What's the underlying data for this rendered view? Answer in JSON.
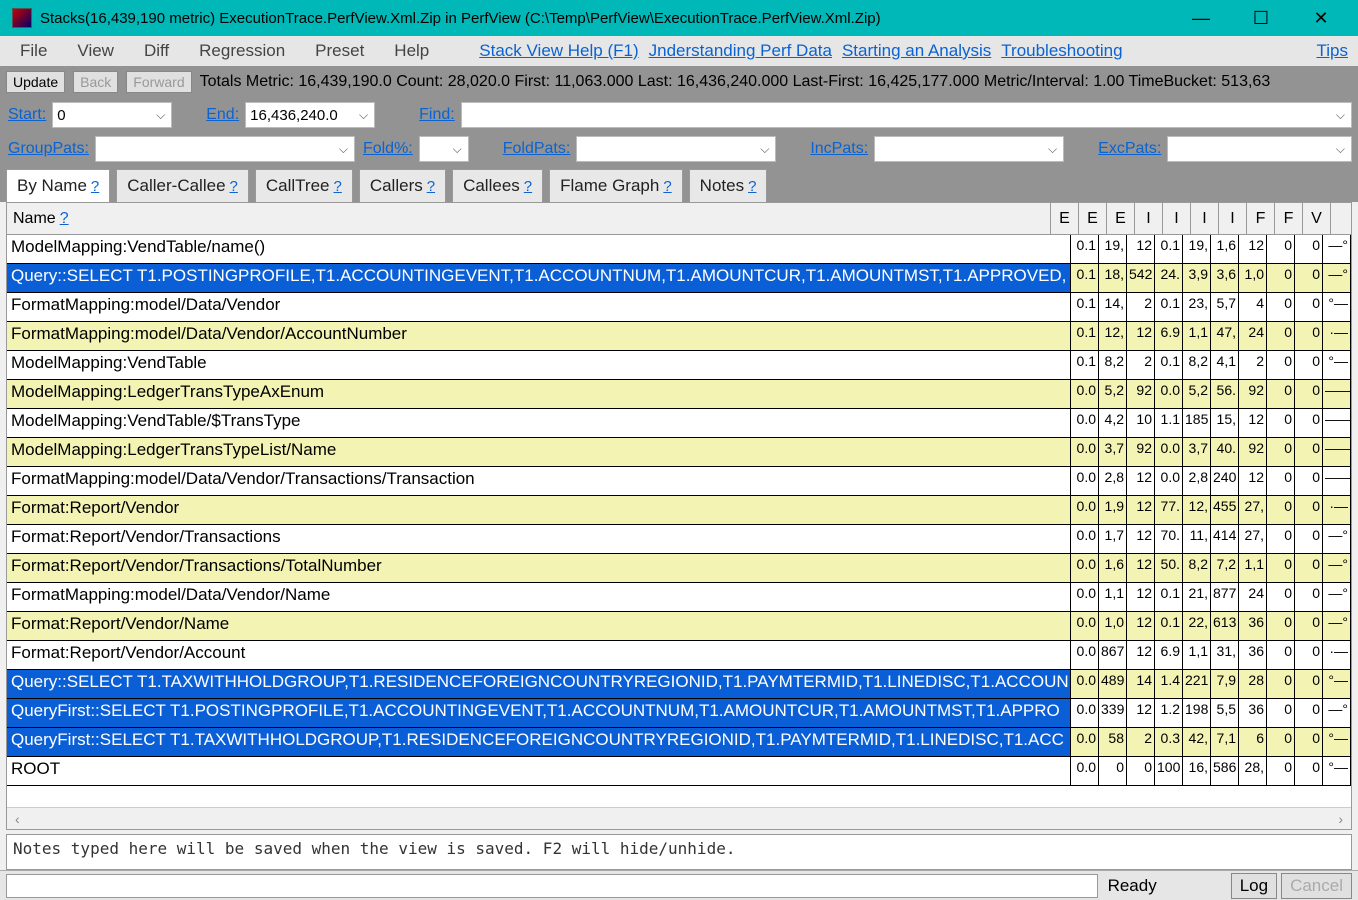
{
  "window": {
    "title": "Stacks(16,439,190 metric) ExecutionTrace.PerfView.Xml.Zip in PerfView (C:\\Temp\\PerfView\\ExecutionTrace.PerfView.Xml.Zip)"
  },
  "menubar": {
    "items": [
      "File",
      "View",
      "Diff",
      "Regression",
      "Preset",
      "Help"
    ],
    "links": {
      "stackview": "Stack View Help (F1)",
      "understanding": "Jnderstanding Perf Data",
      "starting": "Starting an Analysis",
      "troubleshooting": "Troubleshooting",
      "tips": "Tips"
    }
  },
  "toolbar": {
    "update": "Update",
    "back": "Back",
    "forward": "Forward",
    "totals": "Totals Metric: 16,439,190.0   Count: 28,020.0   First: 11,063.000  Last: 16,436,240.000   Last-First: 16,425,177.000   Metric/Interval: 1.00   TimeBucket: 513,63"
  },
  "filterbar1": {
    "start_label": "Start:",
    "start_value": "0",
    "end_label": "End:",
    "end_value": "16,436,240.0",
    "find_label": "Find:"
  },
  "filterbar2": {
    "grouppats": "GroupPats:",
    "foldpct": "Fold%:",
    "foldpats": "FoldPats:",
    "incpats": "IncPats:",
    "excpats": "ExcPats:"
  },
  "tabs": [
    "By Name",
    "Caller-Callee",
    "CallTree",
    "Callers",
    "Callees",
    "Flame Graph",
    "Notes"
  ],
  "grid": {
    "headers": {
      "name": "Name",
      "cols": [
        "E",
        "E",
        "E",
        "I",
        "I",
        "I",
        "I",
        "F",
        "F",
        "V"
      ]
    },
    "rows": [
      {
        "name": "ModelMapping:VendTable/name()",
        "vals": [
          "0.1",
          "19,",
          "12",
          "0.1",
          "19,",
          "1,6",
          "12",
          "0",
          "0",
          "—°"
        ],
        "sel": false
      },
      {
        "name": "Query::SELECT T1.POSTINGPROFILE,T1.ACCOUNTINGEVENT,T1.ACCOUNTNUM,T1.AMOUNTCUR,T1.AMOUNTMST,T1.APPROVED,",
        "vals": [
          "0.1",
          "18,",
          "542",
          "24.",
          "3,9",
          "3,6",
          "1,0",
          "0",
          "0",
          "—°"
        ],
        "sel": true
      },
      {
        "name": "FormatMapping:model/Data/Vendor",
        "vals": [
          "0.1",
          "14,",
          "2",
          "0.1",
          "23,",
          "5,7",
          "4",
          "0",
          "0",
          "°—"
        ],
        "sel": false
      },
      {
        "name": "FormatMapping:model/Data/Vendor/AccountNumber",
        "vals": [
          "0.1",
          "12,",
          "12",
          "6.9",
          "1,1",
          "47,",
          "24",
          "0",
          "0",
          "·—"
        ],
        "sel": false
      },
      {
        "name": "ModelMapping:VendTable",
        "vals": [
          "0.1",
          "8,2",
          "2",
          "0.1",
          "8,2",
          "4,1",
          "2",
          "0",
          "0",
          "°—"
        ],
        "sel": false
      },
      {
        "name": "ModelMapping:LedgerTransTypeAxEnum",
        "vals": [
          "0.0",
          "5,2",
          "92",
          "0.0",
          "5,2",
          "56.",
          "92",
          "0",
          "0",
          "——"
        ],
        "sel": false
      },
      {
        "name": "ModelMapping:VendTable/$TransType",
        "vals": [
          "0.0",
          "4,2",
          "10",
          "1.1",
          "185",
          "15,",
          "12",
          "0",
          "0",
          "——"
        ],
        "sel": false
      },
      {
        "name": "ModelMapping:LedgerTransTypeList/Name",
        "vals": [
          "0.0",
          "3,7",
          "92",
          "0.0",
          "3,7",
          "40.",
          "92",
          "0",
          "0",
          "——"
        ],
        "sel": false
      },
      {
        "name": "FormatMapping:model/Data/Vendor/Transactions/Transaction",
        "vals": [
          "0.0",
          "2,8",
          "12",
          "0.0",
          "2,8",
          "240",
          "12",
          "0",
          "0",
          "——"
        ],
        "sel": false
      },
      {
        "name": "Format:Report/Vendor",
        "vals": [
          "0.0",
          "1,9",
          "12",
          "77.",
          "12,",
          "455",
          "27,",
          "0",
          "0",
          "·—"
        ],
        "sel": false
      },
      {
        "name": "Format:Report/Vendor/Transactions",
        "vals": [
          "0.0",
          "1,7",
          "12",
          "70.",
          "11,",
          "414",
          "27,",
          "0",
          "0",
          "—°"
        ],
        "sel": false
      },
      {
        "name": "Format:Report/Vendor/Transactions/TotalNumber",
        "vals": [
          "0.0",
          "1,6",
          "12",
          "50.",
          "8,2",
          "7,2",
          "1,1",
          "0",
          "0",
          "—°"
        ],
        "sel": false
      },
      {
        "name": "FormatMapping:model/Data/Vendor/Name",
        "vals": [
          "0.0",
          "1,1",
          "12",
          "0.1",
          "21,",
          "877",
          "24",
          "0",
          "0",
          "—°"
        ],
        "sel": false
      },
      {
        "name": "Format:Report/Vendor/Name",
        "vals": [
          "0.0",
          "1,0",
          "12",
          "0.1",
          "22,",
          "613",
          "36",
          "0",
          "0",
          "—°"
        ],
        "sel": false
      },
      {
        "name": "Format:Report/Vendor/Account",
        "vals": [
          "0.0",
          "867",
          "12",
          "6.9",
          "1,1",
          "31,",
          "36",
          "0",
          "0",
          "·—"
        ],
        "sel": false
      },
      {
        "name": "Query::SELECT T1.TAXWITHHOLDGROUP,T1.RESIDENCEFOREIGNCOUNTRYREGIONID,T1.PAYMTERMID,T1.LINEDISC,T1.ACCOUN",
        "vals": [
          "0.0",
          "489",
          "14",
          "1.4",
          "221",
          "7,9",
          "28",
          "0",
          "0",
          "°—"
        ],
        "sel": true
      },
      {
        "name": "QueryFirst::SELECT T1.POSTINGPROFILE,T1.ACCOUNTINGEVENT,T1.ACCOUNTNUM,T1.AMOUNTCUR,T1.AMOUNTMST,T1.APPRO",
        "vals": [
          "0.0",
          "339",
          "12",
          "1.2",
          "198",
          "5,5",
          "36",
          "0",
          "0",
          "—°"
        ],
        "sel": true
      },
      {
        "name": "QueryFirst::SELECT T1.TAXWITHHOLDGROUP,T1.RESIDENCEFOREIGNCOUNTRYREGIONID,T1.PAYMTERMID,T1.LINEDISC,T1.ACC",
        "vals": [
          "0.0",
          "58",
          "2",
          "0.3",
          "42,",
          "7,1",
          "6",
          "0",
          "0",
          "°—"
        ],
        "sel": true
      },
      {
        "name": "ROOT",
        "vals": [
          "0.0",
          "0",
          "0",
          "100",
          "16,",
          "586",
          "28,",
          "0",
          "0",
          "°—"
        ],
        "sel": false
      }
    ]
  },
  "notes_placeholder": "Notes typed here will be saved when the view is saved.  F2 will hide/unhide.",
  "statusbar": {
    "ready": "Ready",
    "log": "Log",
    "cancel": "Cancel"
  }
}
